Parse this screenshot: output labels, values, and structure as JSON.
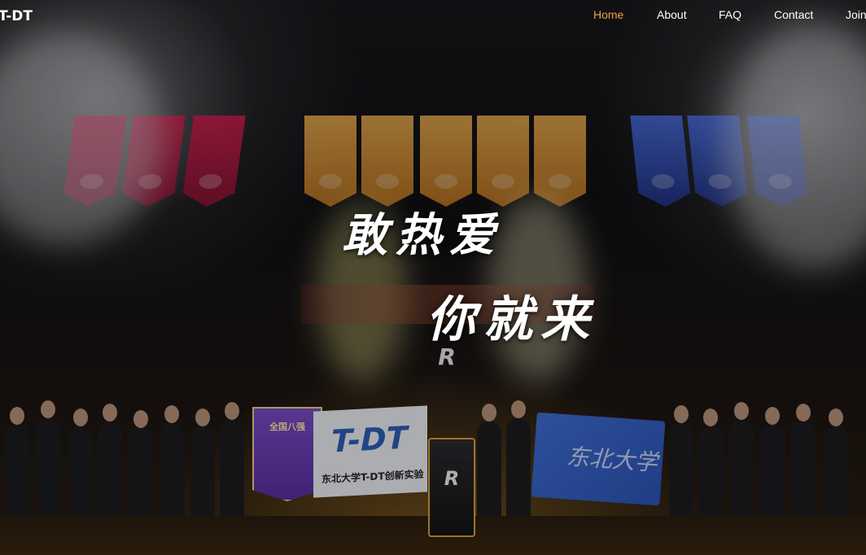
{
  "nav": {
    "logo": "T-DT",
    "links": [
      {
        "label": "Home",
        "active": true
      },
      {
        "label": "About",
        "active": false
      },
      {
        "label": "FAQ",
        "active": false
      },
      {
        "label": "Contact",
        "active": false
      },
      {
        "label": "Join",
        "active": false
      }
    ],
    "active_color": "#f3a23b",
    "text_color": "#ffffff"
  },
  "hero": {
    "slogan_line1": "敢热爱",
    "slogan_line2": "你就来",
    "banners_icon": "championship-banners",
    "stage_logo": "R",
    "flags": {
      "purple": "全国八强",
      "white_title": "T-DT",
      "white_sub": "东北大学T-DT创新实验",
      "blue": "东北大学"
    }
  }
}
